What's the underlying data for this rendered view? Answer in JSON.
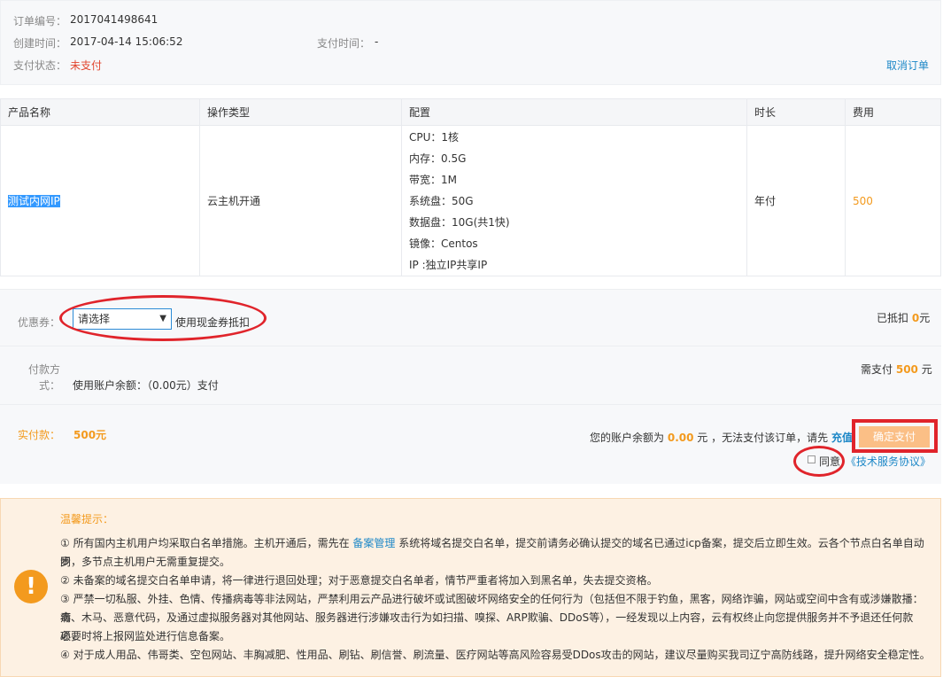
{
  "order": {
    "number_label": "订单编号：",
    "number": "2017041498641",
    "created_label": "创建时间：",
    "created": "2017-04-14 15:06:52",
    "paytime_label": "支付时间：",
    "paytime": "-",
    "status_label": "支付状态：",
    "status": "未支付",
    "cancel": "取消订单"
  },
  "table": {
    "headers": [
      "产品名称",
      "操作类型",
      "配置",
      "时长",
      "费用"
    ],
    "row": {
      "name": "测试内网IP",
      "op": "云主机开通",
      "config": [
        "CPU：1核",
        "内存：0.5G",
        "带宽：1M",
        "系统盘：50G",
        "数据盘：10G(共1快)",
        "镜像：Centos",
        "IP :独立IP共享IP"
      ],
      "duration": "年付",
      "fee": "500"
    }
  },
  "coupon": {
    "label": "优惠券：",
    "select": "请选择",
    "desc": "使用现金券抵扣",
    "deducted_prefix": "已抵扣",
    "deducted_value": "0",
    "deducted_unit": "元"
  },
  "payment": {
    "label_line1": "付款方",
    "label_line2": "式：",
    "method": "使用账户余额：（0.00元）支付",
    "need_prefix": "需支付",
    "need_value": "500",
    "need_unit": "元"
  },
  "actual": {
    "label": "实付款：",
    "value": "500元",
    "balance_prefix": "您的账户余额为",
    "balance_value": "0.00",
    "balance_suffix": "元 ，无法支付该订单，请先",
    "recharge": "充值",
    "confirm_button": "确定支付",
    "agree": "同意",
    "agreement": "《技术服务协议》"
  },
  "notice": {
    "title": "温馨提示：",
    "p1_a": "① 所有国内主机用户均采取白名单措施。主机开通后，需先在",
    "p1_link": "备案管理",
    "p1_b": "系统将域名提交白名单，提交前请务必确认提交的域名已通过icp备案，提交后立即生效。云各个节点白名单自动同",
    "p1_c": "步，多节点主机用户无需重复提交。",
    "p2": "② 未备案的域名提交白名单申请，将一律进行退回处理；对于恶意提交白名单者，情节严重者将加入到黑名单，失去提交资格。",
    "p3_a": "③ 严禁一切私服、外挂、色情、传播病毒等非法网站，严禁利用云产品进行破坏或试图破坏网络安全的任何行为（包括但不限于钓鱼，黑客，网络诈骗，网站或空间中含有或涉嫌散播：病",
    "p3_b": "毒、木马、恶意代码，及通过虚拟服务器对其他网站、服务器进行涉嫌攻击行为如扫描、嗅探、ARP欺骗、DDoS等），一经发现以上内容，云有权终止向您提供服务并不予退还任何款项，",
    "p3_c": "必要时将上报网监处进行信息备案。",
    "p4": "④ 对于成人用品、伟哥类、空包网站、丰胸减肥、性用品、刷钻、刷信誉、刷流量、医疗网站等高风险容易受DDos攻击的网站，建议尽量购买我司辽宁高防线路，提升网络安全稳定性。"
  }
}
